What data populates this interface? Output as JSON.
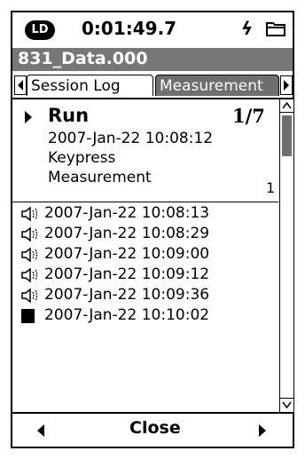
{
  "status": {
    "badge": "LD",
    "elapsed": "0:01:49.7",
    "power_glyph": "ϟ",
    "power_icon": "lightning-icon",
    "folder_icon": "folder-icon"
  },
  "file": {
    "name": "831_Data.000"
  },
  "tabs": [
    {
      "label": "Session Log",
      "active": true
    },
    {
      "label": "Measurement",
      "active": false
    }
  ],
  "run": {
    "label": "Run",
    "index": "1/7",
    "timestamp": "2007-Jan-22 10:08:12",
    "trigger": "Keypress",
    "type": "Measurement",
    "count": "1"
  },
  "events": [
    {
      "icon": "speaker-icon",
      "timestamp": "2007-Jan-22 10:08:13"
    },
    {
      "icon": "speaker-icon",
      "timestamp": "2007-Jan-22 10:08:29"
    },
    {
      "icon": "speaker-icon",
      "timestamp": "2007-Jan-22 10:09:00"
    },
    {
      "icon": "speaker-icon",
      "timestamp": "2007-Jan-22 10:09:12"
    },
    {
      "icon": "speaker-icon",
      "timestamp": "2007-Jan-22 10:09:36"
    },
    {
      "icon": "stop-icon",
      "timestamp": "2007-Jan-22 10:10:02"
    }
  ],
  "footer": {
    "close_label": "Close"
  }
}
